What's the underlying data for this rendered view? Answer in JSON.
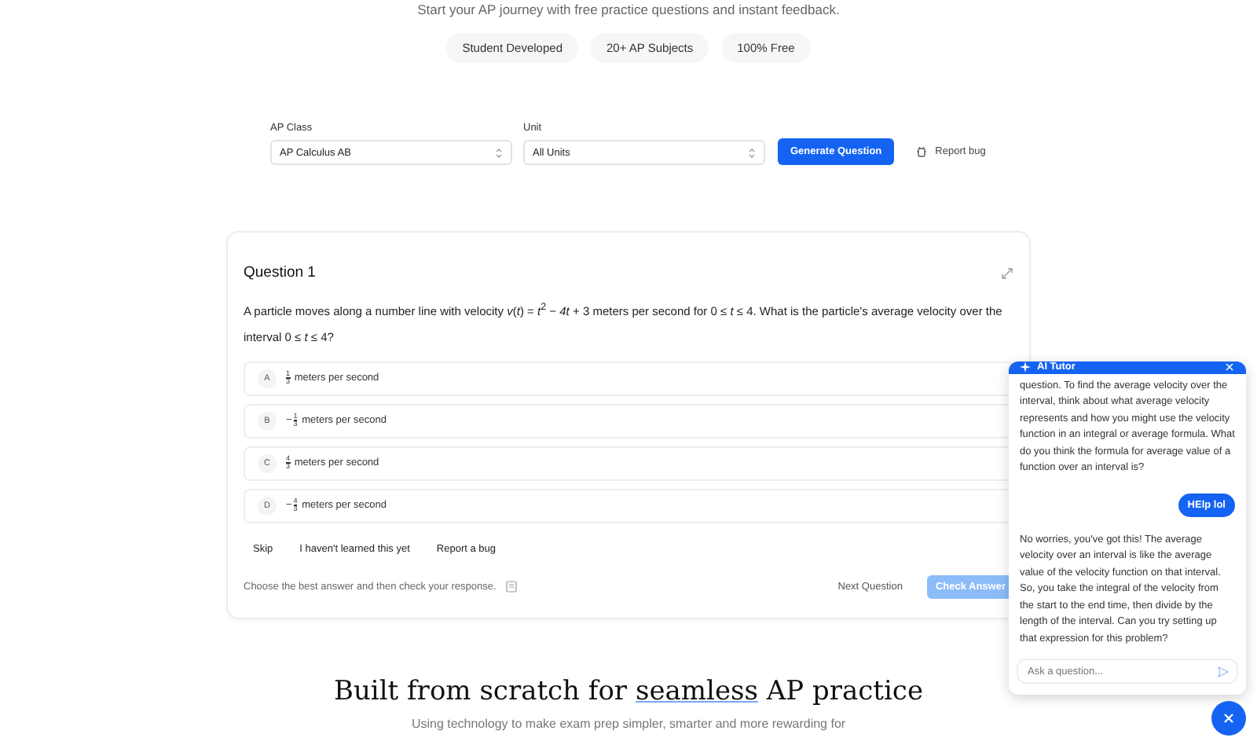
{
  "hero": {
    "subtitle": "Start your AP journey with free practice questions and instant feedback.",
    "pills": [
      "Student Developed",
      "20+ AP Subjects",
      "100% Free"
    ]
  },
  "controls": {
    "class_label": "AP Class",
    "class_value": "AP Calculus AB",
    "unit_label": "Unit",
    "unit_value": "All Units",
    "generate": "Generate Question",
    "report": "Report bug"
  },
  "question": {
    "title": "Question 1",
    "text": "A particle moves along a number line with velocity *v*(*t*) = *t*$^{2}$ − *4t* + 3 meters per second for 0 ≤ *t* ≤ 4. What is the particle's average velocity over the interval 0 ≤ *t* ≤ 4?",
    "options": [
      {
        "letter": "A",
        "numerator": "1",
        "denominator": "3",
        "text": "meters per second",
        "selected": false
      },
      {
        "letter": "B",
        "sign": "−",
        "numerator": "1",
        "denominator": "3",
        "text": "meters per second",
        "selected": false
      },
      {
        "letter": "C",
        "numerator": "4",
        "denominator": "3",
        "text": "meters per second",
        "selected": false
      },
      {
        "letter": "D",
        "sign": "−",
        "numerator": "4",
        "denominator": "3",
        "text": "meters per second",
        "selected": false
      }
    ],
    "actions": [
      "Skip",
      "I haven't learned this yet",
      "Report a bug"
    ],
    "hint": "Choose the best answer and then check your response.",
    "next": "Next Question",
    "check": "Check Answer",
    "check_disabled": true
  },
  "tutor": {
    "title": "AI Tutor",
    "messages": [
      {
        "kind": "bot",
        "text": "question. To find the average velocity over the interval, think about what average velocity represents and how you might use the velocity function in an integral or average formula. What do you think the formula for average value of a function over an interval is?"
      },
      {
        "kind": "user",
        "text": "HElp lol"
      },
      {
        "kind": "bot",
        "text": "No worries, you've got this! The average velocity over an interval is like the average value of the velocity function on that interval. So, you take the integral of the velocity from the start to the end time, then divide by the length of the interval. Can you try setting up that expression for this problem?"
      }
    ],
    "placeholder": "Ask a question..."
  },
  "section": {
    "heading_before": "Built from scratch for ",
    "heading_link": "seamless",
    "heading_after": " AP practice",
    "subtitle": "Using technology to make exam prep simpler, smarter and more rewarding for"
  }
}
